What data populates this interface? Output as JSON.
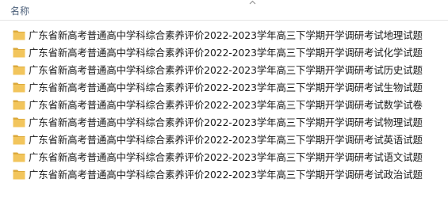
{
  "header": {
    "name_label": "名称"
  },
  "icons": {
    "sort": "chevron-up-icon",
    "folder": "folder-icon"
  },
  "colors": {
    "folder": "#f2c55c",
    "folder_shade": "#dcaa3c",
    "header_text": "#4c607a",
    "text": "#1a1a1a"
  },
  "files": [
    {
      "name": "广东省新高考普通高中学科综合素养评价2022-2023学年高三下学期开学调研考试地理试题"
    },
    {
      "name": "广东省新高考普通高中学科综合素养评价2022-2023学年高三下学期开学调研考试化学试题"
    },
    {
      "name": "广东省新高考普通高中学科综合素养评价2022-2023学年高三下学期开学调研考试历史试题"
    },
    {
      "name": "广东省新高考普通高中学科综合素养评价2022-2023学年高三下学期开学调研考试生物试题"
    },
    {
      "name": "广东省新高考普通高中学科综合素养评价2022-2023学年高三下学期开学调研考试数学试卷"
    },
    {
      "name": "广东省新高考普通高中学科综合素养评价2022-2023学年高三下学期开学调研考试物理试题"
    },
    {
      "name": "广东省新高考普通高中学科综合素养评价2022-2023学年高三下学期开学调研考试英语试题"
    },
    {
      "name": "广东省新高考普通高中学科综合素养评价2022-2023学年高三下学期开学调研考试语文试题"
    },
    {
      "name": "广东省新高考普通高中学科综合素养评价2022-2023学年高三下学期开学调研考试政治试题"
    }
  ]
}
